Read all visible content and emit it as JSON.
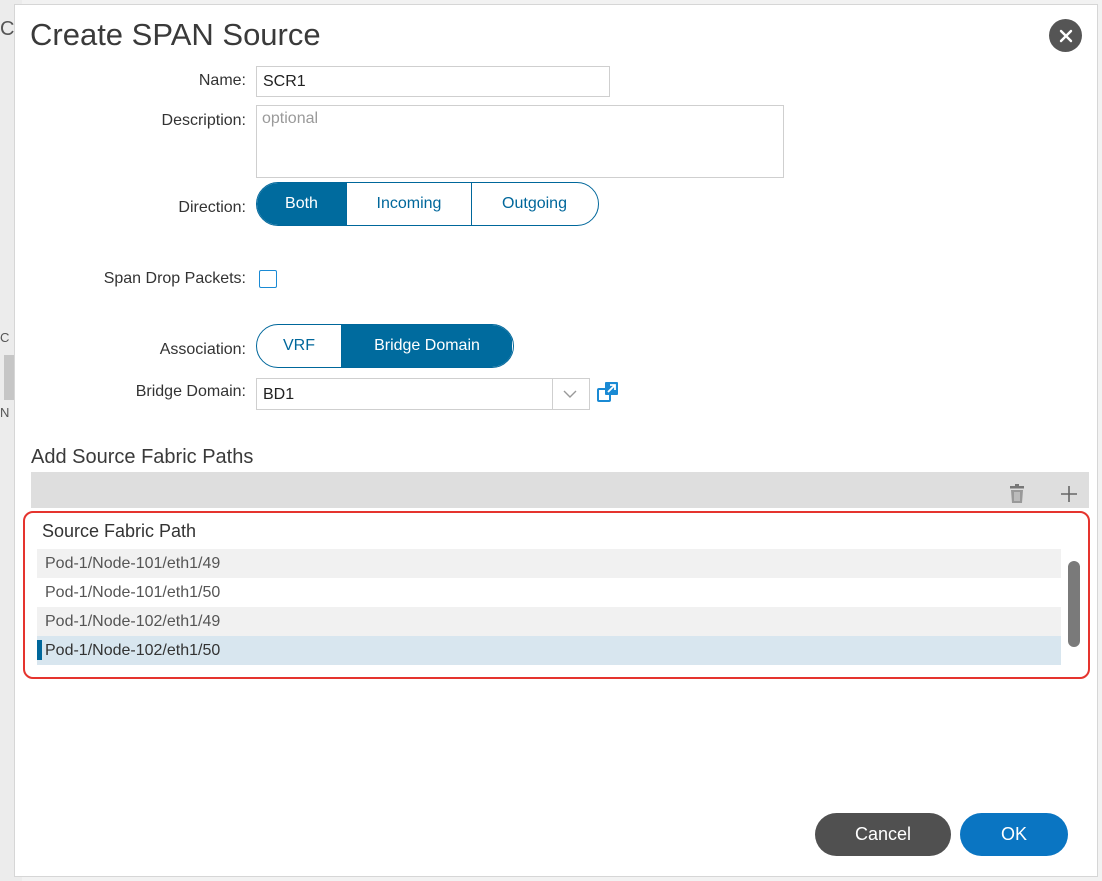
{
  "dialog": {
    "title": "Create SPAN Source"
  },
  "backdrop": {
    "edge_glyphs": [
      "C",
      "C",
      "N"
    ]
  },
  "form": {
    "name_label": "Name:",
    "name_value": "SCR1",
    "description_label": "Description:",
    "description_placeholder": "optional",
    "direction_label": "Direction:",
    "direction_options": [
      "Both",
      "Incoming",
      "Outgoing"
    ],
    "direction_selected": "Both",
    "span_drop_label": "Span Drop Packets:",
    "span_drop_checked": false,
    "association_label": "Association:",
    "association_options": [
      "VRF",
      "Bridge Domain"
    ],
    "association_selected": "Bridge Domain",
    "bridge_domain_label": "Bridge Domain:",
    "bridge_domain_value": "BD1"
  },
  "paths": {
    "section_title": "Add Source Fabric Paths",
    "column_header": "Source Fabric Path",
    "rows": [
      "Pod-1/Node-101/eth1/49",
      "Pod-1/Node-101/eth1/50",
      "Pod-1/Node-102/eth1/49",
      "Pod-1/Node-102/eth1/50"
    ],
    "selected_row": "Pod-1/Node-102/eth1/50"
  },
  "buttons": {
    "cancel": "Cancel",
    "ok": "OK"
  },
  "colors": {
    "accent": "#00679b",
    "primary_button": "#0a75c2",
    "highlight_border": "#e5342e"
  }
}
